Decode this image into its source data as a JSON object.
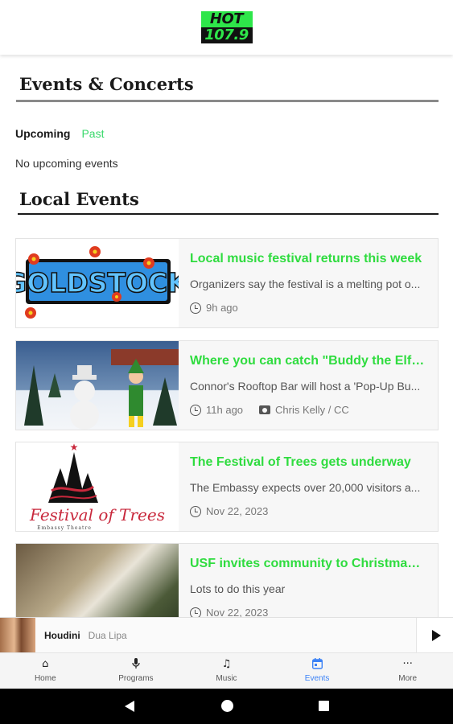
{
  "header": {
    "logo_top": "HOT",
    "logo_bottom": "107.9"
  },
  "events_section": {
    "title": "Events & Concerts",
    "tabs": [
      "Upcoming",
      "Past"
    ],
    "empty_text": "No upcoming events"
  },
  "local_section": {
    "title": "Local Events",
    "articles": [
      {
        "title": "Local music festival returns this week",
        "description": "Organizers say the festival is a melting pot o...",
        "time": "9h ago",
        "credit": "",
        "thumb_text": "GOLDSTOCK"
      },
      {
        "title": "Where you can catch \"Buddy the Elf\" ...",
        "description": "Connor's Rooftop Bar will host a 'Pop-Up Bu...",
        "time": "11h ago",
        "credit": "Chris Kelly / CC",
        "thumb_text": ""
      },
      {
        "title": "The Festival of Trees gets underway",
        "description": "The Embassy expects over 20,000 visitors a...",
        "time": "Nov 22, 2023",
        "credit": "",
        "thumb_text": "Festival of Trees",
        "thumb_subtext": "Embassy Theatre"
      },
      {
        "title": "USF invites community to Christmas ...",
        "description": "Lots to do this year",
        "time": "Nov 22, 2023",
        "credit": "",
        "thumb_text": ""
      }
    ]
  },
  "player": {
    "song": "Houdini",
    "artist": "Dua Lipa",
    "play_icon": "play-icon"
  },
  "bottom_nav": {
    "items": [
      {
        "label": "Home",
        "icon": "home-icon",
        "glyph": "⌂"
      },
      {
        "label": "Programs",
        "icon": "microphone-icon",
        "glyph": "🎙"
      },
      {
        "label": "Music",
        "icon": "music-note-icon",
        "glyph": "♫"
      },
      {
        "label": "Events",
        "icon": "calendar-icon",
        "glyph": "▣"
      },
      {
        "label": "More",
        "icon": "more-icon",
        "glyph": "···"
      }
    ],
    "active": "Events"
  },
  "colors": {
    "accent_green": "#2fdc3f",
    "past_tab": "#39d96b",
    "active_nav": "#3b82f6"
  }
}
